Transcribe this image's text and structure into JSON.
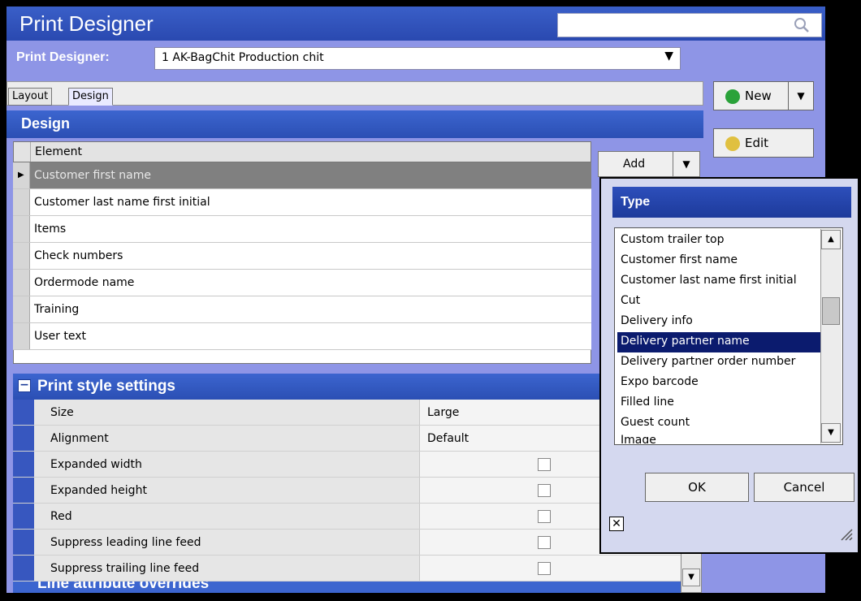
{
  "window": {
    "title": "Print Designer"
  },
  "search": {
    "placeholder": ""
  },
  "designer": {
    "label": "Print Designer:",
    "selected": "1 AK-BagChit Production chit"
  },
  "tabs": [
    {
      "label": "Layout"
    },
    {
      "label": "Design"
    }
  ],
  "toolbar": {
    "new_label": "New",
    "edit_label": "Edit"
  },
  "design": {
    "section_title": "Design",
    "grid_header": "Element",
    "rows": [
      "Customer first name",
      "Customer last name first initial",
      "Items",
      "Check numbers",
      "Ordermode name",
      "Training",
      "User text"
    ],
    "add_label": "Add"
  },
  "print_style": {
    "title": "Print style settings",
    "rows": [
      {
        "name": "Size",
        "value": "Large"
      },
      {
        "name": "Alignment",
        "value": "Default"
      },
      {
        "name": "Expanded width",
        "checked": false
      },
      {
        "name": "Expanded height",
        "checked": false
      },
      {
        "name": "Red",
        "checked": false
      },
      {
        "name": "Suppress leading line feed",
        "checked": false
      },
      {
        "name": "Suppress trailing line feed",
        "checked": false
      }
    ]
  },
  "next_section": {
    "title": "Line attribute overrides"
  },
  "type_popup": {
    "title": "Type",
    "options": [
      "Custom trailer top",
      "Customer first name",
      "Customer last name first initial",
      "Cut",
      "Delivery info",
      "Delivery partner name",
      "Delivery partner order number",
      "Expo barcode",
      "Filled line",
      "Guest count",
      "Image"
    ],
    "selected": "Delivery partner name",
    "ok_label": "OK",
    "cancel_label": "Cancel"
  },
  "colors": {
    "header_blue": "#2b4fb4",
    "window_bg": "#8e95e6",
    "selection": "#0b1b6e"
  }
}
